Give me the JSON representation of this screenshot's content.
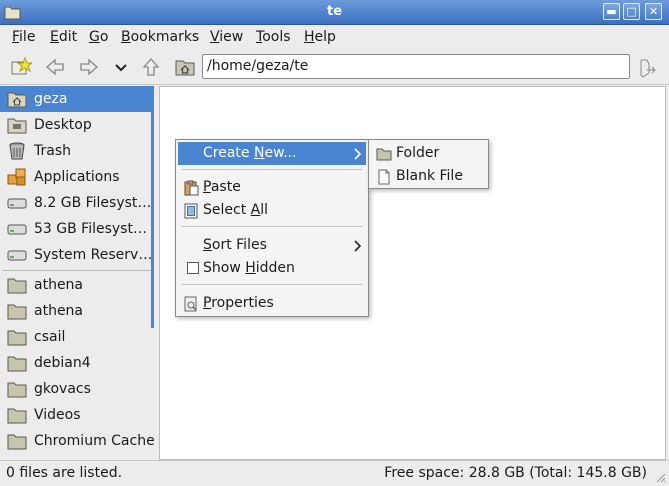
{
  "window": {
    "title": "te"
  },
  "titlebar_buttons": {
    "minimize": "▬",
    "maximize": "□",
    "close": "✕"
  },
  "menubar": [
    {
      "label": "File",
      "u": "F",
      "rest": "ile"
    },
    {
      "label": "Edit",
      "u": "E",
      "rest": "dit"
    },
    {
      "label": "Go",
      "u": "G",
      "rest": "o"
    },
    {
      "label": "Bookmarks",
      "u": "B",
      "rest": "ookmarks"
    },
    {
      "label": "View",
      "u": "V",
      "rest": "iew"
    },
    {
      "label": "Tools",
      "u": "T",
      "rest": "ools"
    },
    {
      "label": "Help",
      "u": "H",
      "rest": "elp"
    }
  ],
  "location": {
    "path": "/home/geza/te"
  },
  "sidebar": {
    "items": [
      {
        "label": "geza",
        "icon": "home-folder-icon",
        "selected": true
      },
      {
        "label": "Desktop",
        "icon": "desktop-folder-icon"
      },
      {
        "label": "Trash",
        "icon": "trash-icon"
      },
      {
        "label": "Applications",
        "icon": "applications-icon"
      },
      {
        "label": "8.2 GB Filesyst…",
        "icon": "drive-icon"
      },
      {
        "label": "53 GB Filesyst…",
        "icon": "drive-icon"
      },
      {
        "label": "System Reserv…",
        "icon": "drive-icon"
      },
      {
        "label": "athena",
        "icon": "folder-icon"
      },
      {
        "label": "athena",
        "icon": "folder-icon"
      },
      {
        "label": "csail",
        "icon": "folder-icon"
      },
      {
        "label": "debian4",
        "icon": "folder-icon"
      },
      {
        "label": "gkovacs",
        "icon": "folder-icon"
      },
      {
        "label": "Videos",
        "icon": "folder-icon"
      },
      {
        "label": "Chromium Cache",
        "icon": "folder-icon"
      }
    ]
  },
  "context_menu": {
    "create_new": {
      "pre": "Create ",
      "u": "N",
      "post": "ew..."
    },
    "paste": {
      "u": "P",
      "post": "aste"
    },
    "select_all": {
      "pre": "Select ",
      "u": "A",
      "post": "ll"
    },
    "sort_files": {
      "u": "S",
      "post": "ort Files"
    },
    "show_hidden": {
      "pre": "Show ",
      "u": "H",
      "post": "idden"
    },
    "properties": {
      "u": "P",
      "post": "roperties"
    }
  },
  "submenu": {
    "folder": "Folder",
    "blank_file": "Blank File"
  },
  "status": {
    "left": "0 files are listed.",
    "right": "Free space: 28.8 GB (Total: 145.8 GB)"
  },
  "colors": {
    "accent": "#4a85d2",
    "titlebar": "#4f82cf"
  }
}
